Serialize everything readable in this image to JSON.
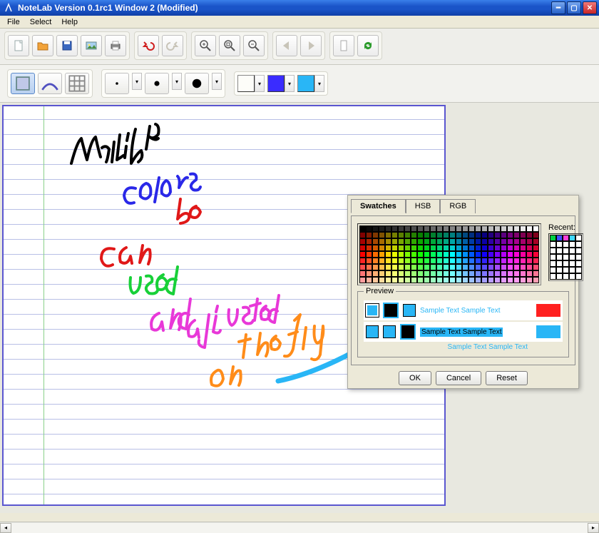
{
  "title": "NoteLab Version 0.1rc1 Window 2 (Modified)",
  "menu": {
    "file": "File",
    "select": "Select",
    "help": "Help"
  },
  "color_panel": {
    "tabs": {
      "swatches": "Swatches",
      "hsb": "HSB",
      "rgb": "RGB"
    },
    "recent_label": "Recent:",
    "preview_label": "Preview",
    "sample_text": "Sample Text Sample Text",
    "buttons": {
      "ok": "OK",
      "cancel": "Cancel",
      "reset": "Reset"
    },
    "preview_fg": "#29b6f6",
    "preview_bg1": "#ff2020",
    "preview_bg2": "#29b6f6",
    "recent_colors": [
      "#00d040",
      "#4050ff",
      "#ff40d8",
      "#40d8ff"
    ]
  },
  "current_colors": {
    "c1": "#000000",
    "c2": "#3a2cff",
    "c3": "#29b6f6"
  },
  "handwriting": [
    {
      "text": "multiple",
      "color": "#000000"
    },
    {
      "text": "colors",
      "color": "#2a28e8"
    },
    {
      "text": "be",
      "color": "#e01818"
    },
    {
      "text": "can",
      "color": "#e01818"
    },
    {
      "text": "used",
      "color": "#18d038"
    },
    {
      "text": "and",
      "color": "#e838d8"
    },
    {
      "text": "adjusted",
      "color": "#e838d8"
    },
    {
      "text": "on",
      "color": "#ff8c1a"
    },
    {
      "text": "the fly",
      "color": "#ff8c1a"
    }
  ],
  "arrow_color": "#29b6f6"
}
